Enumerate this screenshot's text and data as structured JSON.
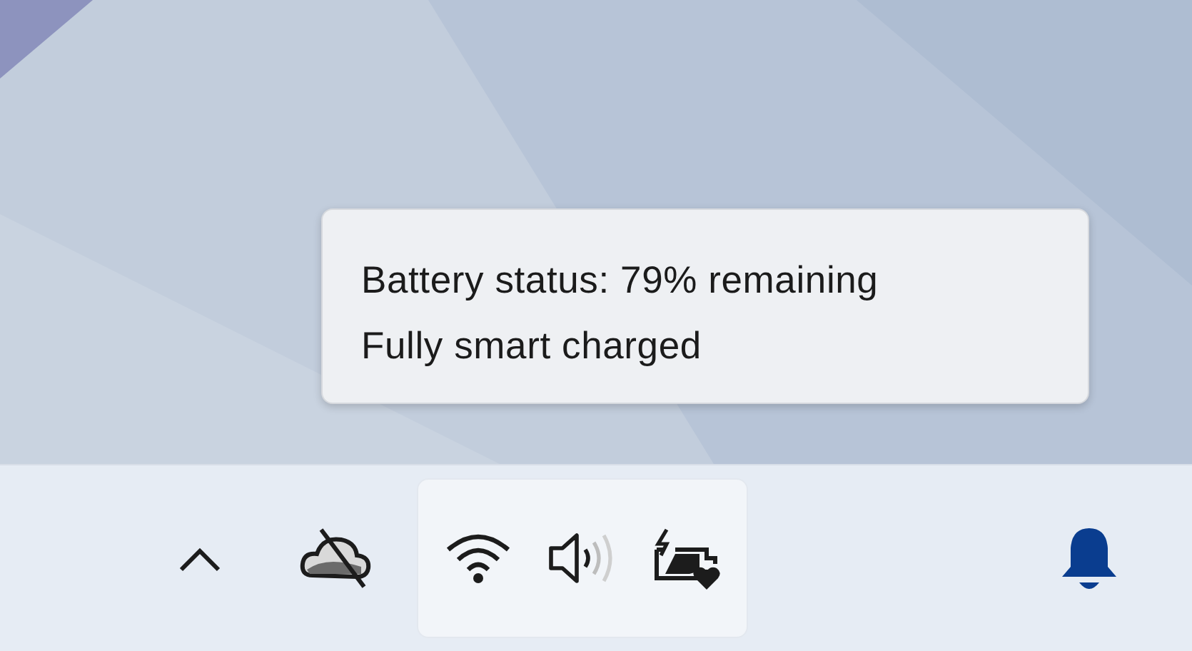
{
  "tooltip": {
    "lines": [
      "Battery status: 79% remaining",
      "Fully smart charged"
    ]
  },
  "tray_icons": [
    {
      "kind": "chevron"
    },
    {
      "kind": "cloud"
    }
  ],
  "quick_settings": [
    {
      "kind": "wifi"
    },
    {
      "kind": "volume"
    },
    {
      "kind": "battery"
    }
  ],
  "notifications": {
    "kind": "bell"
  }
}
